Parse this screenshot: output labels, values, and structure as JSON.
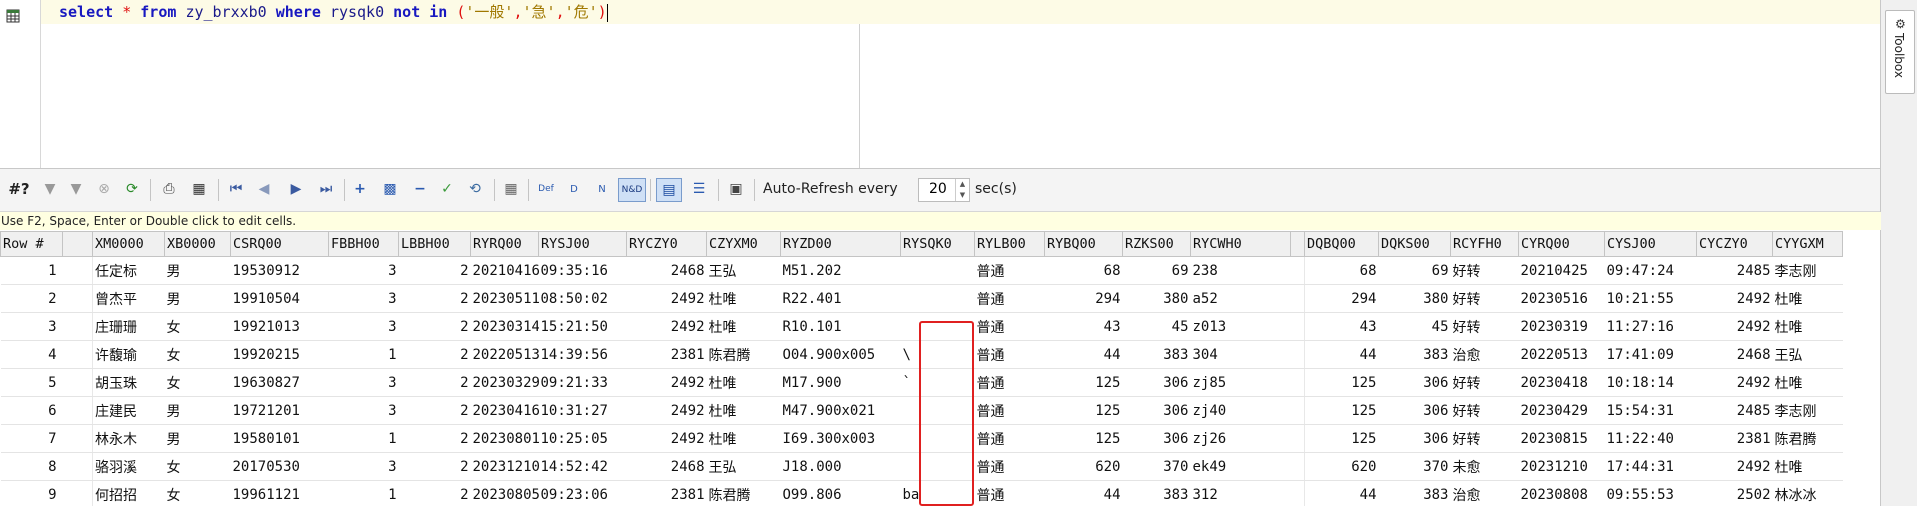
{
  "editor": {
    "sql_tokens": [
      {
        "t": "select",
        "c": "kw"
      },
      {
        "t": " ",
        "c": ""
      },
      {
        "t": "*",
        "c": "op"
      },
      {
        "t": " ",
        "c": ""
      },
      {
        "t": "from",
        "c": "kw"
      },
      {
        "t": " ",
        "c": ""
      },
      {
        "t": "zy_brxxb0",
        "c": "id"
      },
      {
        "t": " ",
        "c": ""
      },
      {
        "t": "where",
        "c": "kw"
      },
      {
        "t": " ",
        "c": ""
      },
      {
        "t": "rysqk0",
        "c": "id"
      },
      {
        "t": " ",
        "c": ""
      },
      {
        "t": "not",
        "c": "kw"
      },
      {
        "t": " ",
        "c": ""
      },
      {
        "t": "in",
        "c": "kw"
      },
      {
        "t": " ",
        "c": ""
      },
      {
        "t": "(",
        "c": "par"
      },
      {
        "t": "'一般'",
        "c": "str"
      },
      {
        "t": ",",
        "c": "par"
      },
      {
        "t": "'急'",
        "c": "str"
      },
      {
        "t": ",",
        "c": "par"
      },
      {
        "t": "'危'",
        "c": "str"
      },
      {
        "t": ")",
        "c": "par"
      }
    ]
  },
  "toolbox": {
    "label": "Toolbox"
  },
  "toolbar": {
    "row_count_label": "#?",
    "auto_refresh_label": "Auto-Refresh every",
    "refresh_value": "20",
    "refresh_unit": "sec(s)",
    "nd_label": "N&D"
  },
  "hint": "Use F2, Space, Enter or Double click to edit cells.",
  "grid": {
    "columns": [
      "Row #",
      "",
      "XM0000",
      "XB0000",
      "CSRQ00",
      "FBBH00",
      "LBBH00",
      "RYRQ00",
      "RYSJ00",
      "RYCZY0",
      "CZYXM0",
      "RYZD00",
      "RYSQK0",
      "RYLB00",
      "RYBQ00",
      "RZKS00",
      "RYCWH0",
      "",
      "DQBQ00",
      "DQKS00",
      "RCYFH0",
      "CYRQ00",
      "CYSJ00",
      "CYCZY0",
      "CYYGXM"
    ],
    "rows": [
      [
        "1",
        "",
        "任定标",
        "男",
        "19530912",
        "3",
        "2",
        "20210416",
        "09:35:16",
        "2468",
        "王弘",
        "M51.202",
        "",
        "普通",
        "68",
        "69",
        "238",
        "",
        "68",
        "69",
        "好转",
        "20210425",
        "09:47:24",
        "2485",
        "李志刚"
      ],
      [
        "2",
        "",
        "曾杰平",
        "男",
        "19910504",
        "3",
        "2",
        "20230511",
        "08:50:02",
        "2492",
        "杜唯",
        "R22.401",
        "",
        "普通",
        "294",
        "380",
        "a52",
        "",
        "294",
        "380",
        "好转",
        "20230516",
        "10:21:55",
        "2492",
        "杜唯"
      ],
      [
        "3",
        "",
        "庄珊珊",
        "女",
        "19921013",
        "3",
        "2",
        "20230314",
        "15:21:50",
        "2492",
        "杜唯",
        "R10.101",
        "",
        "普通",
        "43",
        "45",
        "z013",
        "",
        "43",
        "45",
        "好转",
        "20230319",
        "11:27:16",
        "2492",
        "杜唯"
      ],
      [
        "4",
        "",
        "许馥瑜",
        "女",
        "19920215",
        "1",
        "2",
        "20220513",
        "14:39:56",
        "2381",
        "陈君腾",
        "O04.900x005",
        "\\",
        "普通",
        "44",
        "383",
        "304",
        "",
        "44",
        "383",
        "治愈",
        "20220513",
        "17:41:09",
        "2468",
        "王弘"
      ],
      [
        "5",
        "",
        "胡玉珠",
        "女",
        "19630827",
        "3",
        "2",
        "20230329",
        "09:21:33",
        "2492",
        "杜唯",
        "M17.900",
        "`",
        "普通",
        "125",
        "306",
        "zj85",
        "",
        "125",
        "306",
        "好转",
        "20230418",
        "10:18:14",
        "2492",
        "杜唯"
      ],
      [
        "6",
        "",
        "庄建民",
        "男",
        "19721201",
        "3",
        "2",
        "20230416",
        "10:31:27",
        "2492",
        "杜唯",
        "M47.900x021",
        "",
        "普通",
        "125",
        "306",
        "zj40",
        "",
        "125",
        "306",
        "好转",
        "20230429",
        "15:54:31",
        "2485",
        "李志刚"
      ],
      [
        "7",
        "",
        "林永木",
        "男",
        "19580101",
        "1",
        "2",
        "20230801",
        "10:25:05",
        "2492",
        "杜唯",
        "I69.300x003",
        "",
        "普通",
        "125",
        "306",
        "zj26",
        "",
        "125",
        "306",
        "好转",
        "20230815",
        "11:22:40",
        "2381",
        "陈君腾"
      ],
      [
        "8",
        "",
        "骆羽溪",
        "女",
        "20170530",
        "3",
        "2",
        "20231210",
        "14:52:42",
        "2468",
        "王弘",
        "J18.000",
        "",
        "普通",
        "620",
        "370",
        "ek49",
        "",
        "620",
        "370",
        "未愈",
        "20231210",
        "17:44:31",
        "2492",
        "杜唯"
      ],
      [
        "9",
        "",
        "何招招",
        "女",
        "19961121",
        "1",
        "2",
        "20230805",
        "09:23:06",
        "2381",
        "陈君腾",
        "O99.806",
        "ba",
        "普通",
        "44",
        "383",
        "312",
        "",
        "44",
        "383",
        "治愈",
        "20230808",
        "09:55:53",
        "2502",
        "林冰冰"
      ]
    ]
  }
}
